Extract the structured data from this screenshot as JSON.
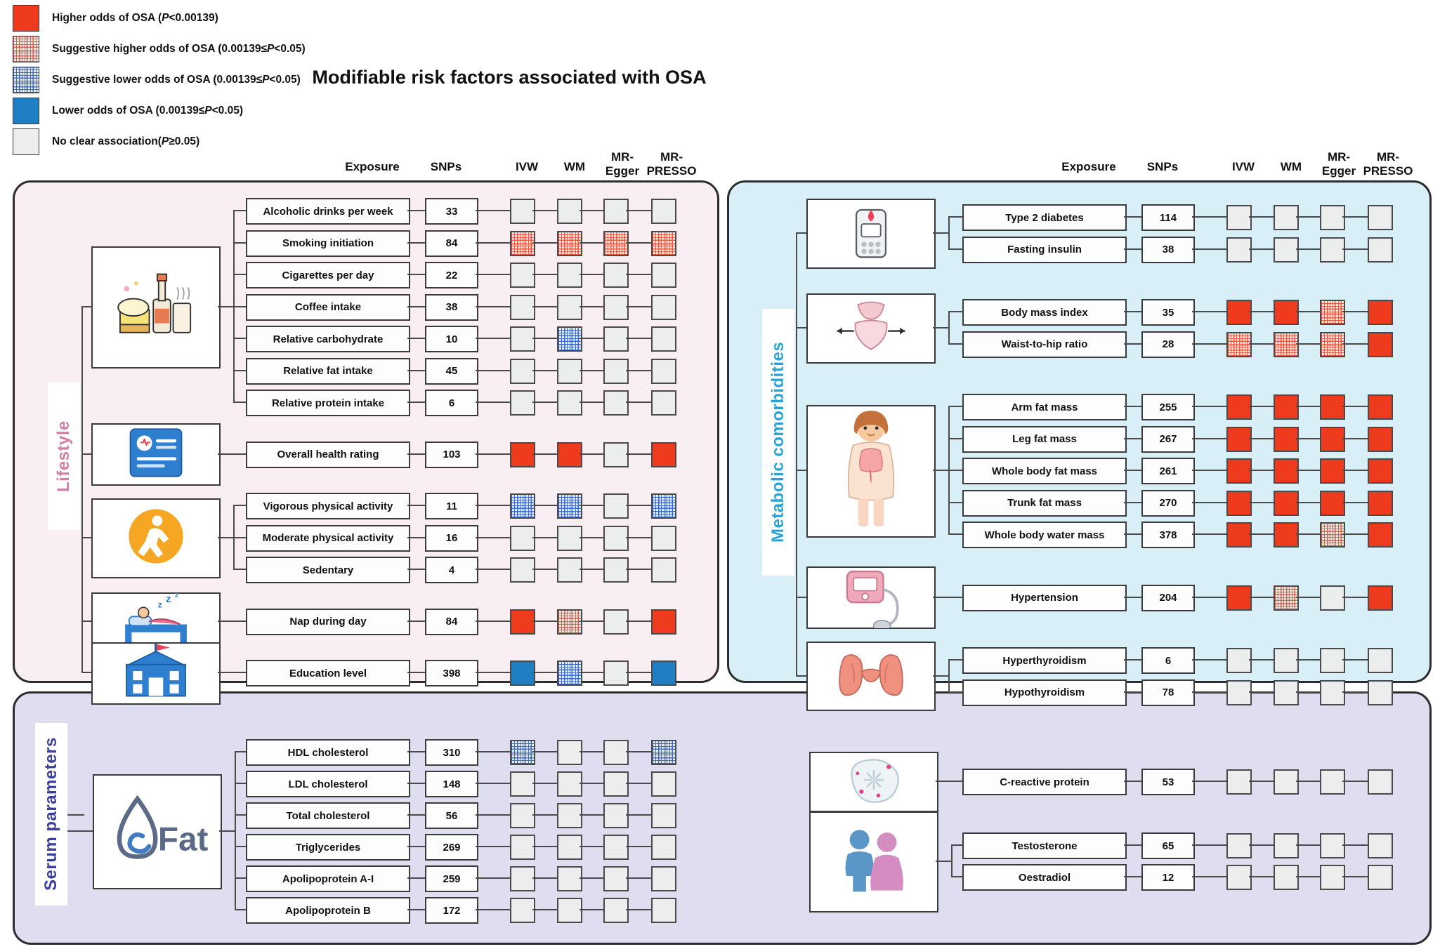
{
  "title": "Modifiable risk factors associated with OSA",
  "legend": [
    {
      "key": "red",
      "swatch": "sw-red",
      "label": "Higher odds of OSA (P<0.00139)"
    },
    {
      "key": "lred",
      "swatch": "sw-lred",
      "label": "Suggestive higher odds of OSA (0.00139≤P<0.05)"
    },
    {
      "key": "lblue",
      "swatch": "sw-lblue",
      "label": "Suggestive lower odds of OSA (0.00139≤P<0.05)"
    },
    {
      "key": "blue",
      "swatch": "sw-blue",
      "label": "Lower odds of OSA (0.00139≤P<0.05)"
    },
    {
      "key": "none",
      "swatch": "sw-none",
      "label": "No clear association(P≥0.05)"
    }
  ],
  "columns": {
    "exposure": "Exposure",
    "snps": "SNPs",
    "ivw": "IVW",
    "wm": "WM",
    "egger": "MR-Egger",
    "presso": "MR-PRESSO"
  },
  "colors": {
    "higher": "#ee3b1e",
    "suggestive_higher": "#fdeeea",
    "suggestive_lower": "#e8eefb",
    "lower": "#1f7fc4",
    "none": "#eceded",
    "lifestyle_panel": "#f9eef1",
    "metabolic_panel": "#d9eff8",
    "serum_panel": "#dedef0",
    "lifestyle_label": "#d37fa8",
    "metabolic_label": "#2aa3d6",
    "serum_label": "#3b3f9e"
  },
  "panels": [
    {
      "id": "lifestyle",
      "label": "Lifestyle",
      "groups": [
        {
          "icon": "alcohol-food-icon",
          "rows": [
            {
              "exposure": "Alcoholic drinks per week",
              "snps": "33",
              "cells": [
                "none",
                "none",
                "none",
                "none"
              ]
            },
            {
              "exposure": "Smoking initiation",
              "snps": "84",
              "cells": [
                "lred",
                "lred",
                "lred",
                "lred"
              ]
            },
            {
              "exposure": "Cigarettes per day",
              "snps": "22",
              "cells": [
                "none",
                "none",
                "none",
                "none"
              ]
            },
            {
              "exposure": "Coffee intake",
              "snps": "38",
              "cells": [
                "none",
                "none",
                "none",
                "none"
              ]
            },
            {
              "exposure": "Relative carbohydrate",
              "snps": "10",
              "cells": [
                "none",
                "lblue",
                "none",
                "none"
              ]
            },
            {
              "exposure": "Relative fat intake",
              "snps": "45",
              "cells": [
                "none",
                "none",
                "none",
                "none"
              ]
            },
            {
              "exposure": "Relative protein intake",
              "snps": "6",
              "cells": [
                "none",
                "none",
                "none",
                "none"
              ]
            }
          ]
        },
        {
          "icon": "health-record-icon",
          "rows": [
            {
              "exposure": "Overall health rating",
              "snps": "103",
              "cells": [
                "red",
                "red",
                "none",
                "red"
              ]
            }
          ]
        },
        {
          "icon": "physical-activity-icon",
          "rows": [
            {
              "exposure": "Vigorous physical activity",
              "snps": "11",
              "cells": [
                "lblue",
                "lblue",
                "none",
                "lblue"
              ]
            },
            {
              "exposure": "Moderate physical activity",
              "snps": "16",
              "cells": [
                "none",
                "none",
                "none",
                "none"
              ]
            },
            {
              "exposure": "Sedentary",
              "snps": "4",
              "cells": [
                "none",
                "none",
                "none",
                "none"
              ]
            }
          ]
        },
        {
          "icon": "sleep-nap-icon",
          "rows": [
            {
              "exposure": "Nap during day",
              "snps": "84",
              "cells": [
                "red",
                "lred",
                "none",
                "red"
              ]
            }
          ]
        },
        {
          "icon": "school-education-icon",
          "rows": [
            {
              "exposure": "Education level",
              "snps": "398",
              "cells": [
                "blue",
                "lblue",
                "none",
                "blue"
              ]
            }
          ]
        }
      ]
    },
    {
      "id": "metabolic",
      "label": "Metabolic comorbidities",
      "groups": [
        {
          "icon": "glucometer-icon",
          "rows": [
            {
              "exposure": "Type 2 diabetes",
              "snps": "114",
              "cells": [
                "none",
                "none",
                "none",
                "none"
              ]
            },
            {
              "exposure": "Fasting insulin",
              "snps": "38",
              "cells": [
                "none",
                "none",
                "none",
                "none"
              ]
            }
          ]
        },
        {
          "icon": "waist-measure-icon",
          "rows": [
            {
              "exposure": "Body mass index",
              "snps": "35",
              "cells": [
                "red",
                "red",
                "lred",
                "red"
              ]
            },
            {
              "exposure": "Waist-to-hip ratio",
              "snps": "28",
              "cells": [
                "lred",
                "lred",
                "lred",
                "red"
              ]
            }
          ]
        },
        {
          "icon": "body-composition-icon",
          "rows": [
            {
              "exposure": "Arm fat mass",
              "snps": "255",
              "cells": [
                "red",
                "red",
                "red",
                "red"
              ]
            },
            {
              "exposure": "Leg fat mass",
              "snps": "267",
              "cells": [
                "red",
                "red",
                "red",
                "red"
              ]
            },
            {
              "exposure": "Whole body fat mass",
              "snps": "261",
              "cells": [
                "red",
                "red",
                "red",
                "red"
              ]
            },
            {
              "exposure": "Trunk fat mass",
              "snps": "270",
              "cells": [
                "red",
                "red",
                "red",
                "red"
              ]
            },
            {
              "exposure": "Whole body water mass",
              "snps": "378",
              "cells": [
                "red",
                "red",
                "lred",
                "red"
              ]
            }
          ]
        },
        {
          "icon": "blood-pressure-monitor-icon",
          "rows": [
            {
              "exposure": "Hypertension",
              "snps": "204",
              "cells": [
                "red",
                "lred",
                "none",
                "red"
              ]
            }
          ]
        },
        {
          "icon": "thyroid-icon",
          "rows": [
            {
              "exposure": "Hyperthyroidism",
              "snps": "6",
              "cells": [
                "none",
                "none",
                "none",
                "none"
              ]
            },
            {
              "exposure": "Hypothyroidism",
              "snps": "78",
              "cells": [
                "none",
                "none",
                "none",
                "none"
              ]
            }
          ]
        }
      ]
    },
    {
      "id": "serum",
      "label": "Serum parameters",
      "groups": [
        {
          "icon": "fat-droplet-icon",
          "rows": [
            {
              "exposure": "HDL cholesterol",
              "snps": "310",
              "cells": [
                "lblue",
                "none",
                "none",
                "lblue"
              ]
            },
            {
              "exposure": "LDL cholesterol",
              "snps": "148",
              "cells": [
                "none",
                "none",
                "none",
                "none"
              ]
            },
            {
              "exposure": "Total cholesterol",
              "snps": "56",
              "cells": [
                "none",
                "none",
                "none",
                "none"
              ]
            },
            {
              "exposure": "Triglycerides",
              "snps": "269",
              "cells": [
                "none",
                "none",
                "none",
                "none"
              ]
            },
            {
              "exposure": "Apolipoprotein A-I",
              "snps": "259",
              "cells": [
                "none",
                "none",
                "none",
                "none"
              ]
            },
            {
              "exposure": "Apolipoprotein B",
              "snps": "172",
              "cells": [
                "none",
                "none",
                "none",
                "none"
              ]
            }
          ]
        },
        {
          "icon": "inflammation-cell-icon",
          "rows": [
            {
              "exposure": "C-reactive protein",
              "snps": "53",
              "cells": [
                "none",
                "none",
                "none",
                "none"
              ]
            }
          ]
        },
        {
          "icon": "sex-hormone-icon",
          "rows": [
            {
              "exposure": "Testosterone",
              "snps": "65",
              "cells": [
                "none",
                "none",
                "none",
                "none"
              ]
            },
            {
              "exposure": "Oestradiol",
              "snps": "12",
              "cells": [
                "none",
                "none",
                "none",
                "none"
              ]
            }
          ]
        }
      ]
    }
  ]
}
